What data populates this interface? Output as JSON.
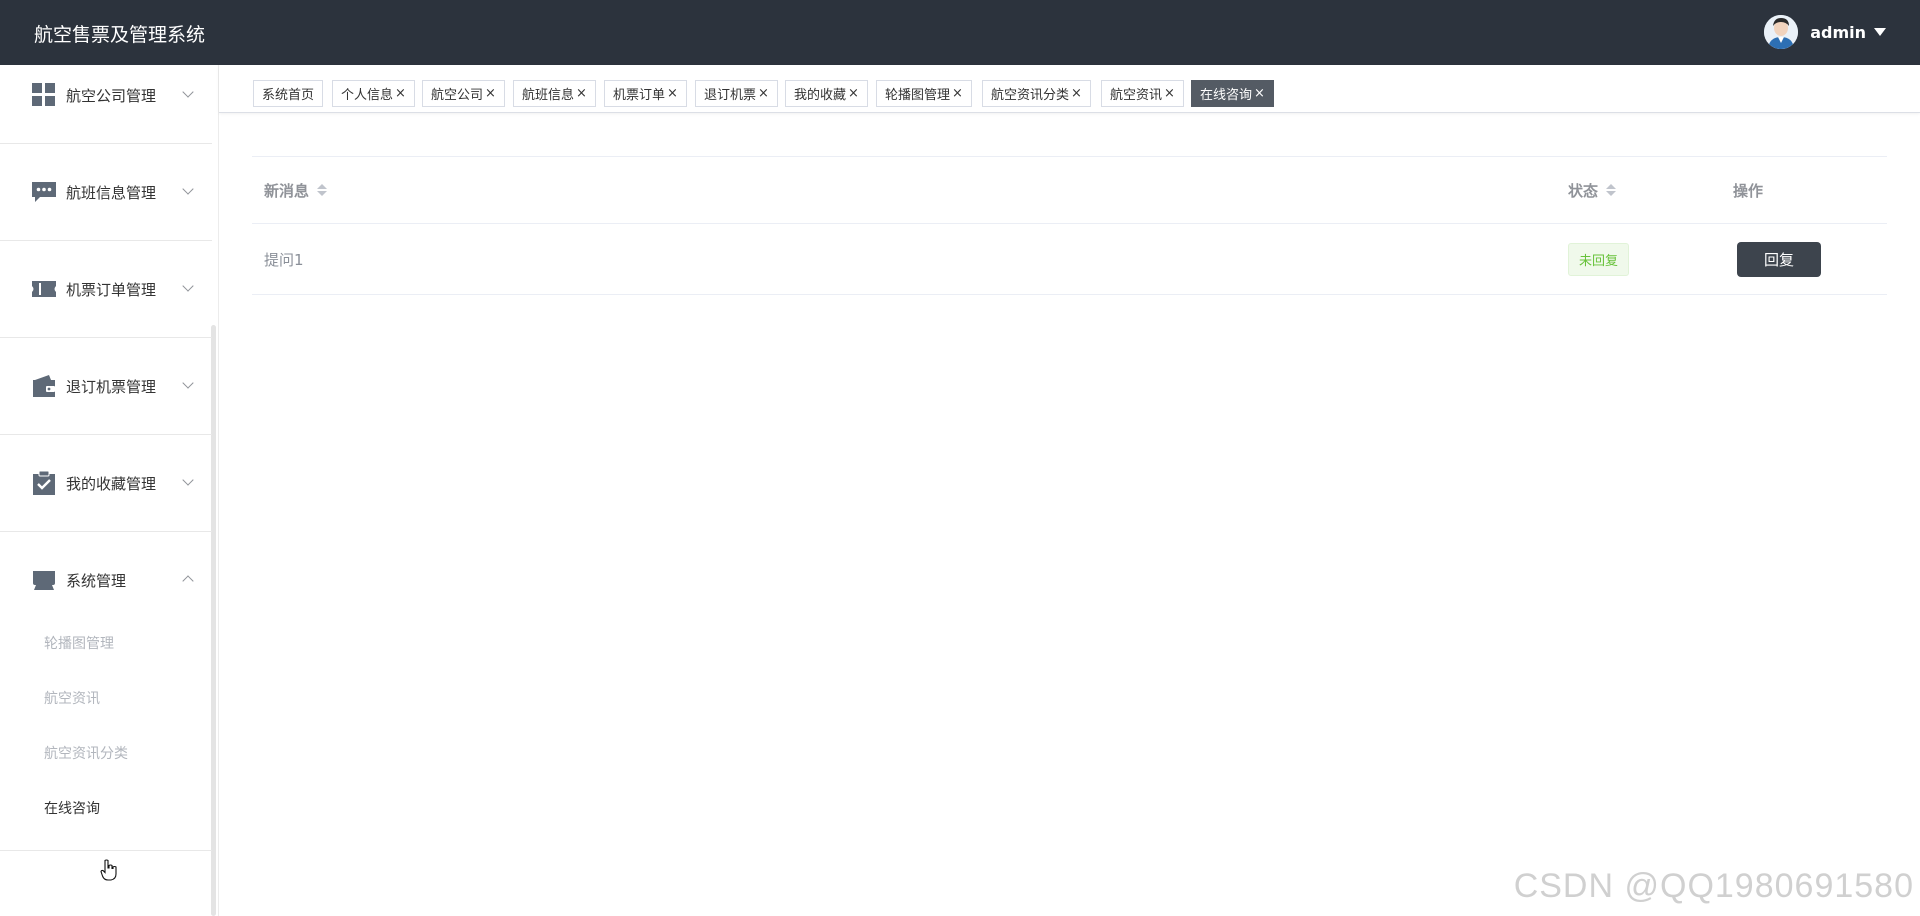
{
  "header": {
    "app_title": "航空售票及管理系统",
    "username": "admin"
  },
  "sidebar": {
    "groups": [
      {
        "label": "航空公司管理",
        "icon": "grid-icon",
        "expanded": false
      },
      {
        "label": "航班信息管理",
        "icon": "chat-bubble-icon",
        "expanded": false
      },
      {
        "label": "机票订单管理",
        "icon": "ticket-icon",
        "expanded": false
      },
      {
        "label": "退订机票管理",
        "icon": "wallet-icon",
        "expanded": false
      },
      {
        "label": "我的收藏管理",
        "icon": "clipboard-check-icon",
        "expanded": false
      },
      {
        "label": "系统管理",
        "icon": "store-icon",
        "expanded": true
      }
    ],
    "submenu": [
      {
        "label": "轮播图管理",
        "active": false
      },
      {
        "label": "航空资讯",
        "active": false
      },
      {
        "label": "航空资讯分类",
        "active": false
      },
      {
        "label": "在线咨询",
        "active": true
      }
    ]
  },
  "tabs": [
    {
      "label": "系统首页",
      "closable": false,
      "active": false
    },
    {
      "label": "个人信息",
      "closable": true,
      "active": false
    },
    {
      "label": "航空公司",
      "closable": true,
      "active": false
    },
    {
      "label": "航班信息",
      "closable": true,
      "active": false
    },
    {
      "label": "机票订单",
      "closable": true,
      "active": false
    },
    {
      "label": "退订机票",
      "closable": true,
      "active": false
    },
    {
      "label": "我的收藏",
      "closable": true,
      "active": false
    },
    {
      "label": "轮播图管理",
      "closable": true,
      "active": false
    },
    {
      "label": "航空资讯分类",
      "closable": true,
      "active": false
    },
    {
      "label": "航空资讯",
      "closable": true,
      "active": false
    },
    {
      "label": "在线咨询",
      "closable": true,
      "active": true
    }
  ],
  "tab_close_glyph": "×",
  "table": {
    "columns": {
      "message": "新消息",
      "status": "状态",
      "action": "操作"
    },
    "rows": [
      {
        "message": "提问1",
        "status": "未回复",
        "action_label": "回复"
      }
    ]
  },
  "colors": {
    "header_bg": "#2c333d",
    "active_tab_bg": "#545b64",
    "reply_button_bg": "#3d444d",
    "status_unreplied": "#67c23a"
  },
  "watermark": "CSDN @QQ1980691580"
}
